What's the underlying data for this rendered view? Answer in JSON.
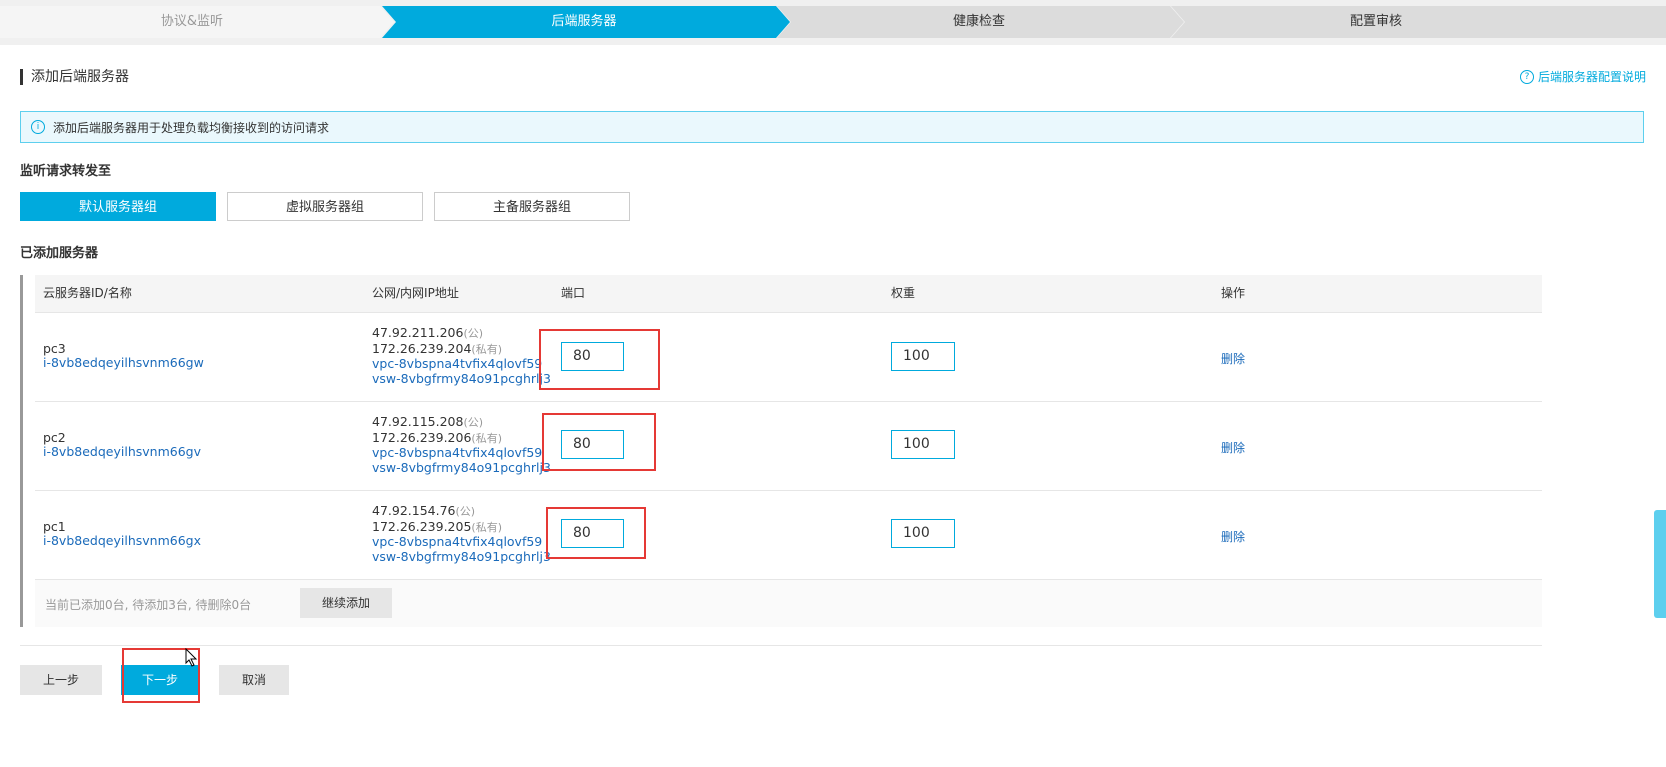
{
  "steps": [
    {
      "label": "协议&监听",
      "state": "done"
    },
    {
      "label": "后端服务器",
      "state": "active"
    },
    {
      "label": "健康检查",
      "state": "todo"
    },
    {
      "label": "配置审核",
      "state": "todo"
    }
  ],
  "panel": {
    "title": "添加后端服务器",
    "help_link": "后端服务器配置说明",
    "info": "添加后端服务器用于处理负载均衡接收到的访问请求",
    "forward_label": "监听请求转发至",
    "groups": [
      "默认服务器组",
      "虚拟服务器组",
      "主备服务器组"
    ],
    "added_label": "已添加服务器"
  },
  "table": {
    "headers": [
      "云服务器ID/名称",
      "公网/内网IP地址",
      "端口",
      "权重",
      "操作"
    ],
    "rows": [
      {
        "name": "pc3",
        "id": "i-8vb8edqeyilhsvnm66gw",
        "public_ip": "47.92.211.206",
        "public_tag": "(公)",
        "private_ip": "172.26.239.204",
        "private_tag": "(私有)",
        "vpc": "vpc-8vbspna4tvfix4qlovf59",
        "vsw": "vsw-8vbgfrmy84o91pcghrlj3",
        "port": "80",
        "weight": "100",
        "action": "删除"
      },
      {
        "name": "pc2",
        "id": "i-8vb8edqeyilhsvnm66gv",
        "public_ip": "47.92.115.208",
        "public_tag": "(公)",
        "private_ip": "172.26.239.206",
        "private_tag": "(私有)",
        "vpc": "vpc-8vbspna4tvfix4qlovf59",
        "vsw": "vsw-8vbgfrmy84o91pcghrlj3",
        "port": "80",
        "weight": "100",
        "action": "删除"
      },
      {
        "name": "pc1",
        "id": "i-8vb8edqeyilhsvnm66gx",
        "public_ip": "47.92.154.76",
        "public_tag": "(公)",
        "private_ip": "172.26.239.205",
        "private_tag": "(私有)",
        "vpc": "vpc-8vbspna4tvfix4qlovf59",
        "vsw": "vsw-8vbgfrmy84o91pcghrlj3",
        "port": "80",
        "weight": "100",
        "action": "删除"
      }
    ],
    "summary": "当前已添加0台, 待添加3台, 待删除0台",
    "add_more": "继续添加"
  },
  "footer": {
    "prev": "上一步",
    "next": "下一步",
    "cancel": "取消"
  },
  "colors": {
    "accent": "#00aadd",
    "link": "#1a6aba",
    "highlight": "#e53935"
  }
}
